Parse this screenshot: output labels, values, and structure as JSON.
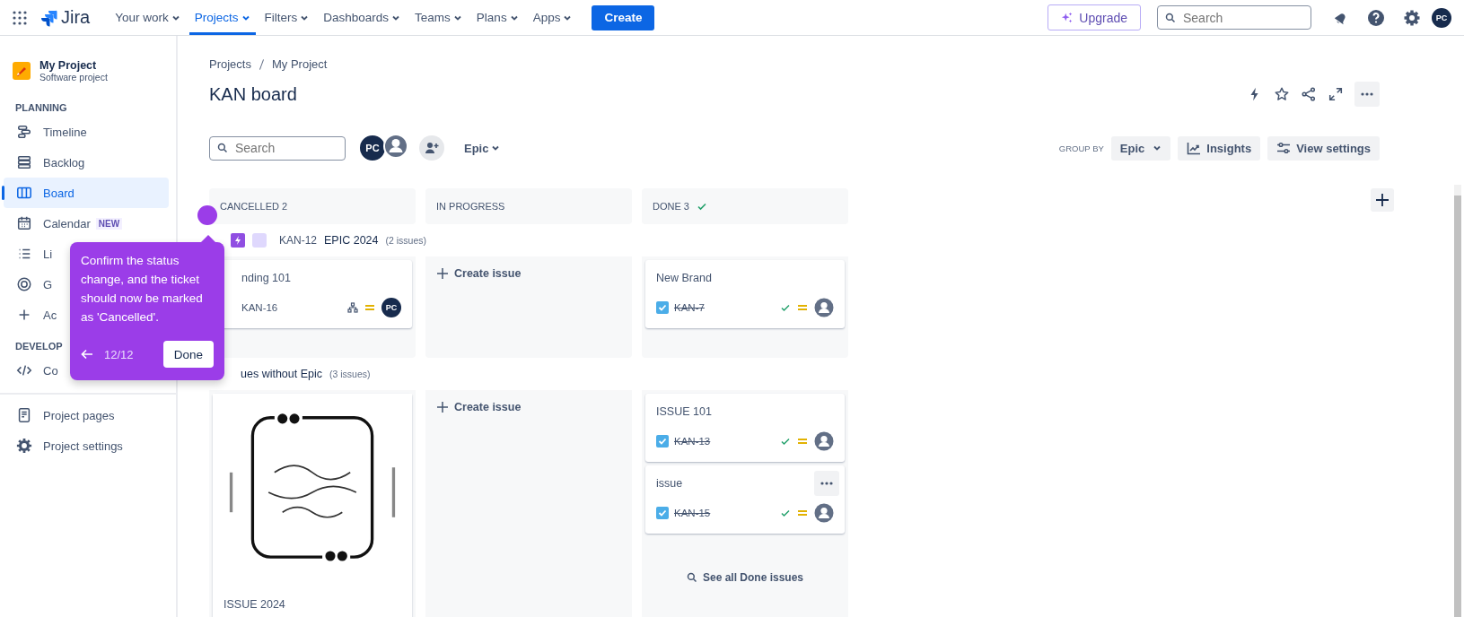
{
  "nav": {
    "logo": "Jira",
    "menus": [
      {
        "label": "Your work",
        "selected": false
      },
      {
        "label": "Projects",
        "selected": true
      },
      {
        "label": "Filters",
        "selected": false
      },
      {
        "label": "Dashboards",
        "selected": false
      },
      {
        "label": "Teams",
        "selected": false
      },
      {
        "label": "Plans",
        "selected": false
      },
      {
        "label": "Apps",
        "selected": false
      }
    ],
    "create": "Create",
    "upgrade": "Upgrade",
    "search": {
      "placeholder": "Search"
    },
    "avatar": "PC"
  },
  "sidebar": {
    "project": {
      "name": "My Project",
      "type": "Software project"
    },
    "groups": [
      {
        "heading": "PLANNING",
        "items": [
          {
            "label": "Timeline",
            "selected": false
          },
          {
            "label": "Backlog",
            "selected": false
          },
          {
            "label": "Board",
            "selected": true
          },
          {
            "label": "Calendar",
            "badge": "NEW",
            "selected": false
          },
          {
            "label": "Li",
            "selected": false
          },
          {
            "label": "G",
            "selected": false
          },
          {
            "label": "Ac",
            "selected": false
          }
        ]
      },
      {
        "heading": "DEVELOP",
        "items": [
          {
            "label": "Co",
            "selected": false
          }
        ]
      },
      {
        "items": [
          {
            "label": "Project pages",
            "selected": false
          },
          {
            "label": "Project settings",
            "selected": false
          }
        ]
      }
    ]
  },
  "main": {
    "breadcrumb": [
      "Projects",
      "My Project"
    ],
    "title": "KAN board",
    "toolbar": {
      "search": {
        "placeholder": "Search"
      },
      "avatars": [
        {
          "kind": "initials",
          "text": "PC"
        },
        {
          "kind": "silhouette"
        }
      ],
      "filter": "Epic",
      "group_by_label": "GROUP BY",
      "group_by": "Epic",
      "buttons": [
        "Insights",
        "View settings"
      ]
    },
    "columns": [
      {
        "title": "CANCELLED 2",
        "done": false
      },
      {
        "title": "IN PROGRESS",
        "done": false
      },
      {
        "title": "DONE 3",
        "done": true
      }
    ],
    "lanes": [
      {
        "key": "KAN-12",
        "title": "EPIC 2024",
        "count": "(2 issues)",
        "cells": [
          {
            "cards": [
              {
                "kind": "issue",
                "title": "nding 101",
                "key": "KAN-16",
                "done": false,
                "assignee": "PC",
                "more": false
              }
            ]
          },
          {
            "create": "Create issue"
          },
          {
            "cards": [
              {
                "kind": "issue",
                "title": "New Brand",
                "key": "KAN-7",
                "done": true,
                "more": false
              }
            ]
          }
        ]
      },
      {
        "title": "ues without Epic",
        "count": "(3 issues)",
        "cells": [
          {
            "cards": [
              {
                "kind": "picture",
                "title": "ISSUE 2024"
              }
            ]
          },
          {
            "create": "Create issue"
          },
          {
            "cards": [
              {
                "kind": "issue",
                "title": "ISSUE 101",
                "key": "KAN-13",
                "done": true,
                "more": false
              },
              {
                "kind": "issue",
                "title": "issue",
                "key": "KAN-15",
                "done": true,
                "more": true
              }
            ],
            "see_all": "See all Done issues"
          }
        ]
      }
    ]
  },
  "tooltip": {
    "text": "Confirm the status change, and the ticket should now be marked as 'Cancelled'.",
    "step": "12/12",
    "button": "Done"
  }
}
